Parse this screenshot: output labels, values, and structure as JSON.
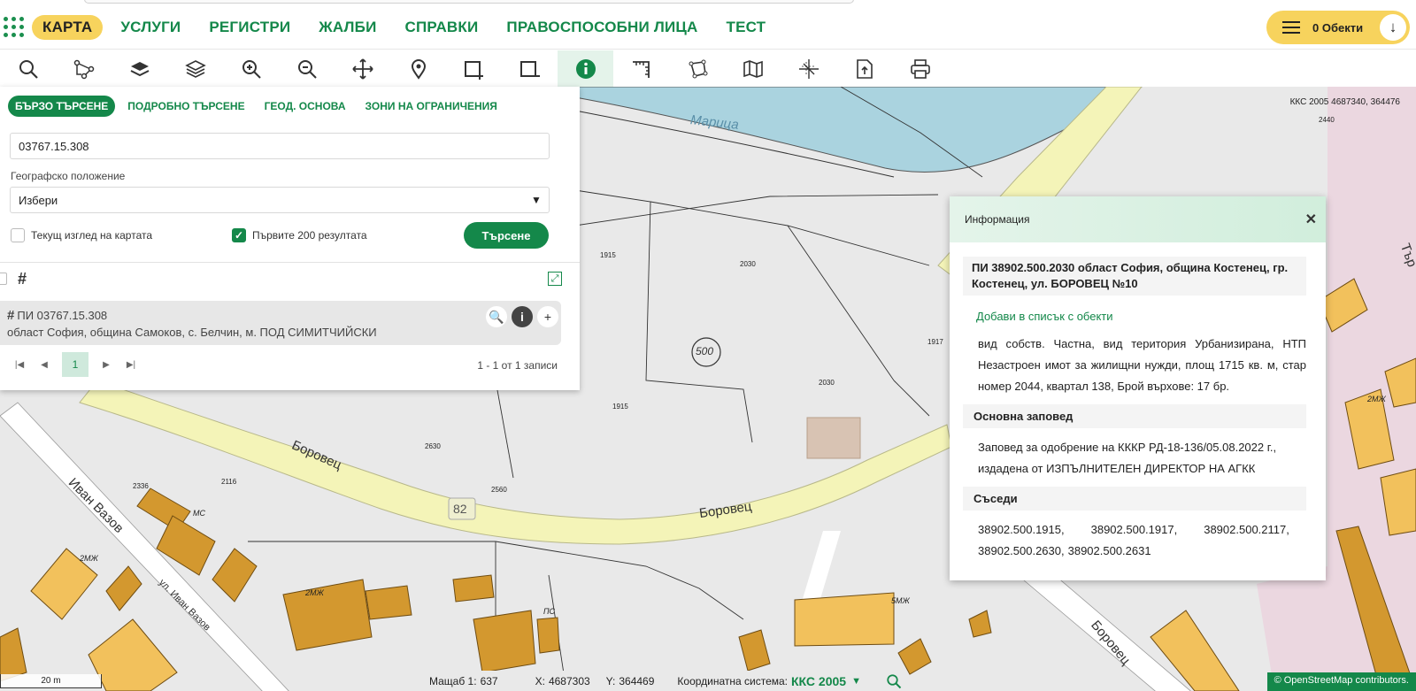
{
  "nav": {
    "items": [
      "КАРТА",
      "УСЛУГИ",
      "РЕГИСТРИ",
      "ЖАЛБИ",
      "СПРАВКИ",
      "ПРАВОСПОСОБНИ ЛИЦА",
      "ТЕСТ"
    ],
    "objects_label": "0 Обекти"
  },
  "colors": {
    "primary": "#14884a",
    "accent": "#f7d35d",
    "road": "#f4f4b8",
    "water": "#aad3df",
    "building": "#f2c15c",
    "building_dark": "#d3982f"
  },
  "toolbar": {
    "icons": [
      "search-icon",
      "route-icon",
      "layer-single-icon",
      "layers-icon",
      "zoom-in-icon",
      "zoom-out-icon",
      "pan-icon",
      "marker-icon",
      "add-area-icon",
      "remove-area-icon",
      "info-icon",
      "measure-icon",
      "polygon-icon",
      "map-icon",
      "grid-icon",
      "export-icon",
      "print-icon"
    ],
    "active": "info-icon"
  },
  "map": {
    "coord_readout": "ККС 2005 4687340, 364476",
    "labels": {
      "river": "Марица",
      "street1": "Боровец",
      "street2": "Боровец",
      "street3": "Иван Вазов",
      "street4": "ул. Иван Вазов",
      "street5": "Боровец",
      "street6": "Тър",
      "zone": "500",
      "road_no": "82",
      "p1915a": "1915",
      "p2030a": "2030",
      "p1917": "1917",
      "p2030b": "2030",
      "p1915b": "1915",
      "p2630": "2630",
      "p2560": "2560",
      "p2116": "2116",
      "p2336": "2336",
      "p2440": "2440",
      "b1": "2МЖ",
      "b2": "МС",
      "b3": "2МЖ",
      "b4": "ПС",
      "b5": "5МЖ",
      "b6": "2МЖ"
    }
  },
  "search_panel": {
    "tabs": [
      "БЪРЗО ТЪРСЕНЕ",
      "ПОДРОБНО ТЪРСЕНЕ",
      "ГЕОД. ОСНОВА",
      "ЗОНИ НА ОГРАНИЧЕНИЯ"
    ],
    "query": "03767.15.308",
    "geo_label": "Географско положение",
    "geo_value": "Избери",
    "cb_current_view": "Текущ изглед на картата",
    "cb_first_200": "Първите 200 резултата",
    "search_button": "Търсене",
    "result_title": "ПИ 03767.15.308",
    "result_sub": "област София, община Самоков, с. Белчин, м. ПОД СИМИТЧИЙСКИ",
    "page": "1",
    "records": "1 - 1 от 1 записи"
  },
  "info_popup": {
    "header": "Информация",
    "title": "ПИ 38902.500.2030 област София, община Костенец, гр. Костенец, ул. БОРОВЕЦ №10",
    "add_link": "Добави в списък с обекти",
    "description": "вид собств. Частна, вид територия Урбанизирана, НТП Незастроен имот за жилищни нужди, площ 1715 кв. м, стар номер 2044, квартал 138, Брой върхове: 17 бр.",
    "order_heading": "Основна заповед",
    "order_text": "Заповед за одобрение на КККР РД-18-136/05.08.2022 г., издадена от ИЗПЪЛНИТЕЛЕН ДИРЕКТОР НА АГКК",
    "neighbors_heading": "Съседи",
    "neighbors": [
      "38902.500.1915,",
      "38902.500.1917,",
      "38902.500.2117,",
      "38902.500.2630,",
      "38902.500.2631"
    ]
  },
  "status_bar": {
    "scale_label": "Мащаб 1:",
    "scale_value": "637",
    "x_label": "X:",
    "x_value": "4687303",
    "y_label": "Y:",
    "y_value": "364469",
    "crs_label": "Координатна система:",
    "crs_value": "ККС 2005",
    "scalebar": "20 m",
    "attribution": "© OpenStreetMap contributors."
  }
}
